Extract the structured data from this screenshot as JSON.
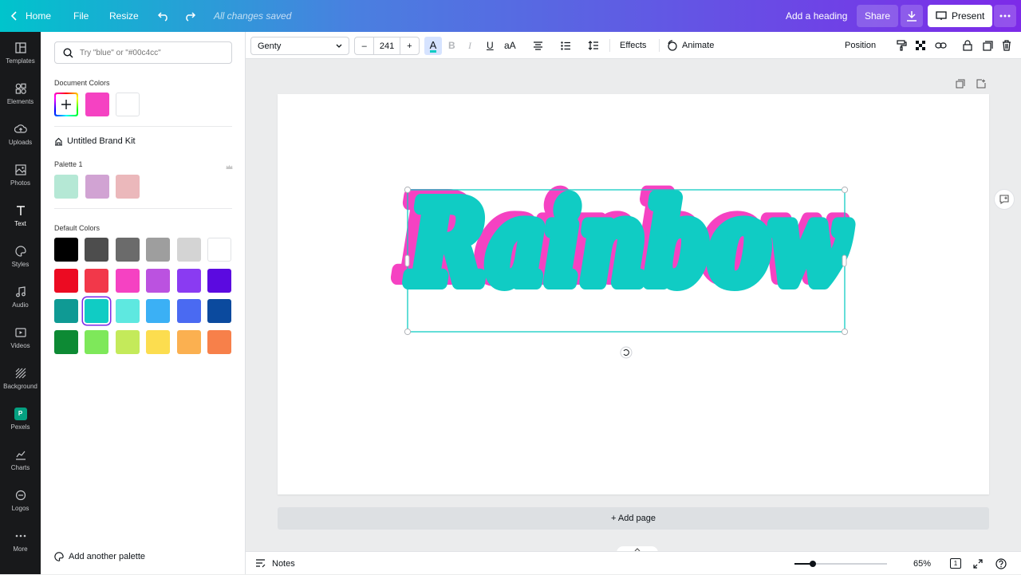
{
  "topbar": {
    "home_label": "Home",
    "file_label": "File",
    "resize_label": "Resize",
    "saved_status": "All changes saved",
    "heading_label": "Add a heading",
    "share_label": "Share",
    "present_label": "Present"
  },
  "rail": {
    "items": [
      {
        "label": "Templates",
        "icon": "templates-icon"
      },
      {
        "label": "Elements",
        "icon": "elements-icon"
      },
      {
        "label": "Uploads",
        "icon": "upload-icon"
      },
      {
        "label": "Photos",
        "icon": "photo-icon"
      },
      {
        "label": "Text",
        "icon": "text-icon",
        "active": true
      },
      {
        "label": "Styles",
        "icon": "palette-icon"
      },
      {
        "label": "Audio",
        "icon": "music-icon"
      },
      {
        "label": "Videos",
        "icon": "video-icon"
      },
      {
        "label": "Background",
        "icon": "background-icon"
      },
      {
        "label": "Pexels",
        "icon": "pexels-icon"
      },
      {
        "label": "Charts",
        "icon": "chart-icon"
      },
      {
        "label": "Logos",
        "icon": "logo-icon"
      },
      {
        "label": "More",
        "icon": "more-icon"
      }
    ]
  },
  "panel": {
    "search_placeholder": "Try \"blue\" or \"#00c4cc\"",
    "document_colors_label": "Document Colors",
    "document_colors": [
      "#f542c2",
      "#ffffff"
    ],
    "brand_kit_label": "Untitled Brand Kit",
    "palette_label": "Palette 1",
    "palette_colors": [
      "#b5e8d5",
      "#d1a3d3",
      "#ebb8bb"
    ],
    "default_colors_label": "Default Colors",
    "default_colors": [
      [
        "#000000",
        "#4d4d4d",
        "#6b6b6b",
        "#9e9e9e",
        "#d4d4d4",
        "#ffffff"
      ],
      [
        "#ec0b22",
        "#f2384a",
        "#f542c2",
        "#bb52e0",
        "#8a3bf2",
        "#5b0ae0"
      ],
      [
        "#0f9a94",
        "#10ccc4",
        "#5ee8e0",
        "#3bb0f5",
        "#4a6af2",
        "#0b4a9e"
      ],
      [
        "#0d8a34",
        "#7ee85a",
        "#c4ea5a",
        "#fcdd4f",
        "#fbb050",
        "#f7804a"
      ]
    ],
    "selected_color": "#10ccc4",
    "add_palette_label": "Add another palette"
  },
  "toolbar": {
    "font_name": "Genty",
    "font_size": "241",
    "decrease_label": "–",
    "increase_label": "+",
    "color_letter": "A",
    "bold_label": "B",
    "italic_label": "I",
    "underline_label": "U",
    "case_label": "aA",
    "effects_label": "Effects",
    "animate_label": "Animate",
    "position_label": "Position"
  },
  "canvas": {
    "text": "Rainbow",
    "text_color": "#10ccc4",
    "shadow_color": "#f542c2",
    "add_page_label": "+ Add page"
  },
  "bottombar": {
    "notes_label": "Notes",
    "zoom_label": "65%",
    "zoom_fraction": 0.2,
    "page_count": "1"
  }
}
